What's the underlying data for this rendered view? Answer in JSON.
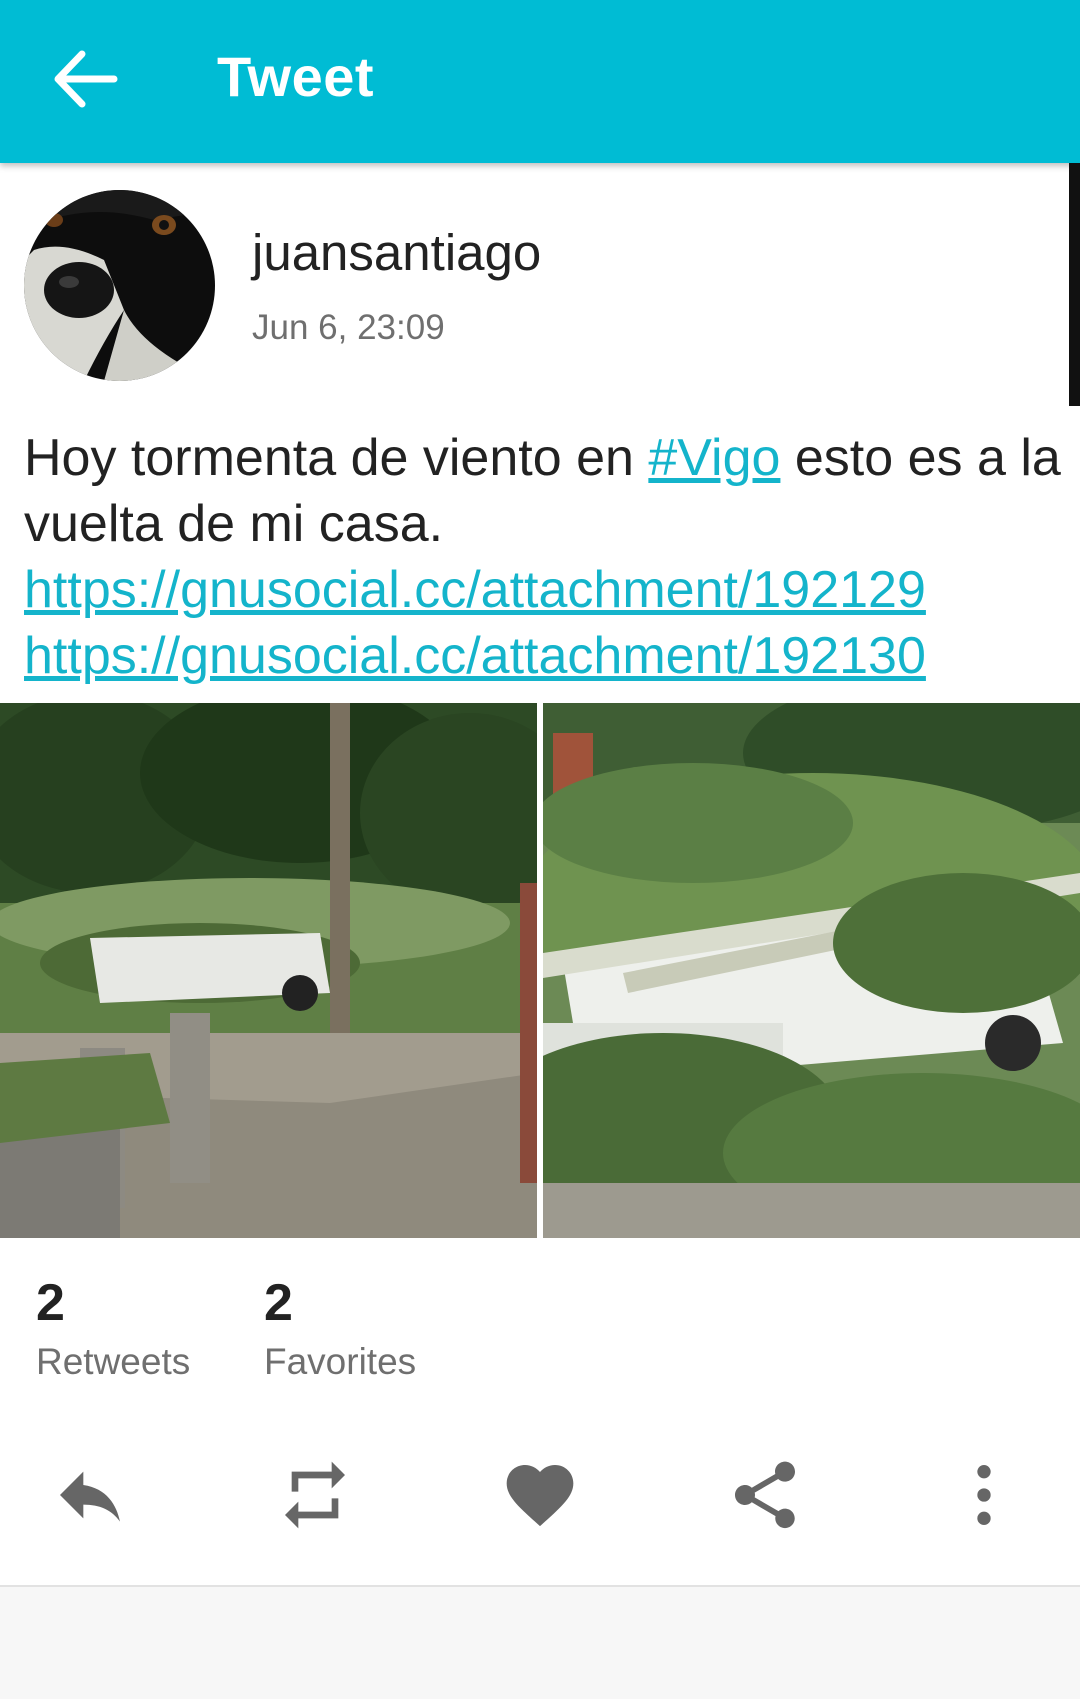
{
  "appbar": {
    "title": "Tweet",
    "back_icon": "arrow-left-icon",
    "background": "#00bcd4"
  },
  "tweet": {
    "username": "juansantiago",
    "timestamp": "Jun 6, 23:09",
    "text_part1": "Hoy tormenta de viento en ",
    "hashtag": "#Vigo",
    "text_part2": " esto es a la vuelta de mi casa.  ",
    "link1": "https://gnusocial.cc/attachment/192129",
    "link2": "https://gnusocial.cc/attachment/192130",
    "link_color": "#14b4cb"
  },
  "stats": {
    "retweets_count": "2",
    "retweets_label": "Retweets",
    "favorites_count": "2",
    "favorites_label": "Favorites"
  },
  "actions": [
    {
      "name": "reply",
      "icon": "reply-icon"
    },
    {
      "name": "retweet",
      "icon": "retweet-icon"
    },
    {
      "name": "favorite",
      "icon": "heart-icon"
    },
    {
      "name": "share",
      "icon": "share-icon"
    },
    {
      "name": "more",
      "icon": "more-vertical-icon"
    }
  ]
}
